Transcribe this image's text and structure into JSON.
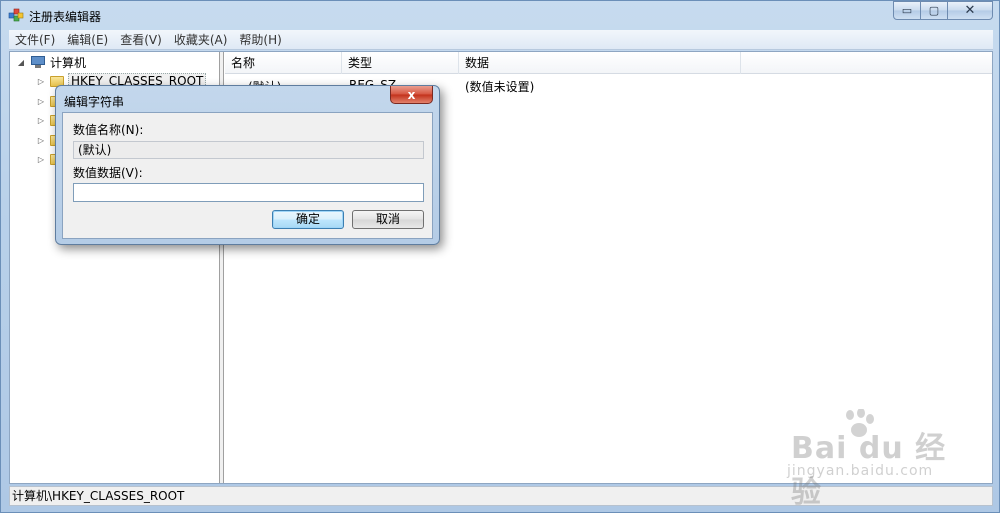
{
  "window": {
    "title": "注册表编辑器",
    "buttons": {
      "minimize": "▭",
      "maximize": "▢",
      "close": "✕"
    }
  },
  "menu": {
    "items": [
      "文件(F)",
      "编辑(E)",
      "查看(V)",
      "收藏夹(A)",
      "帮助(H)"
    ]
  },
  "tree": {
    "root": "计算机",
    "items": [
      {
        "label": "HKEY_CLASSES_ROOT",
        "selected": true
      },
      {
        "label": ""
      },
      {
        "label": ""
      },
      {
        "label": ""
      },
      {
        "label": ""
      },
      {
        "label": ""
      }
    ]
  },
  "list": {
    "columns": [
      "名称",
      "类型",
      "数据"
    ],
    "rows": [
      {
        "name": "(默认)",
        "type": "REG_SZ",
        "data": "(数值未设置)",
        "icon": "ab"
      }
    ]
  },
  "dialog": {
    "title": "编辑字符串",
    "close": "x",
    "name_label": "数值名称(N):",
    "name_value": "(默认)",
    "data_label": "数值数据(V):",
    "data_value": "",
    "ok_label": "确定",
    "cancel_label": "取消"
  },
  "statusbar": {
    "path": "计算机\\HKEY_CLASSES_ROOT"
  },
  "watermark": {
    "main": "Bai du 经验",
    "sub": "jingyan.baidu.com"
  }
}
